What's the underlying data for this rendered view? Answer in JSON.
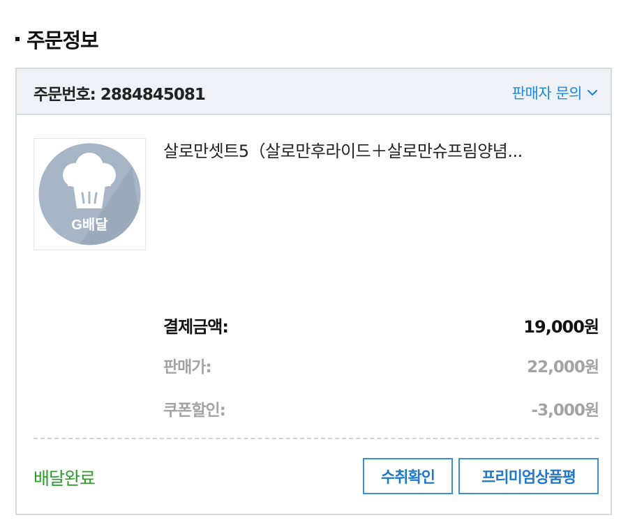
{
  "section": {
    "title": "주문정보"
  },
  "order": {
    "number_label": "주문번호: 2884845081",
    "inquiry_label": "판매자 문의",
    "product": {
      "name": "살로만셋트5（살로만후라이드＋살로만슈프림양념...",
      "thumbnail_label": "G배달",
      "thumbnail_icon": "chef-hat-icon"
    },
    "prices": {
      "total_label": "결제금액:",
      "total_value": "19,000원",
      "sale_label": "판매가:",
      "sale_value": "22,000원",
      "coupon_label": "쿠폰할인:",
      "coupon_value": "-3,000원"
    },
    "status": "배달완료",
    "buttons": {
      "confirm_label": "수취확인",
      "review_label": "프리미엄상품평"
    }
  },
  "colors": {
    "accent_blue": "#1f86d9",
    "status_green": "#2a9d2a",
    "header_bg": "#eef1f5",
    "muted_text": "#a3a3a3"
  }
}
